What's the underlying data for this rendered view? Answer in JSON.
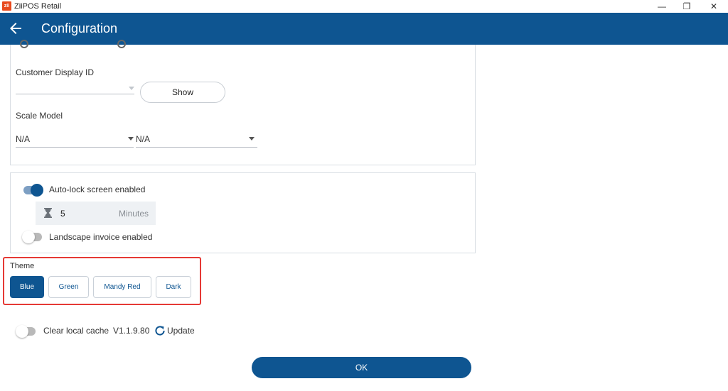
{
  "window": {
    "title": "ZiiPOS Retail",
    "logo_text": "zii",
    "minimize_glyph": "—",
    "restore_glyph": "❐",
    "close_glyph": "✕"
  },
  "appbar": {
    "title": "Configuration",
    "back_icon": "arrow-left-icon"
  },
  "customer_display": {
    "label": "Customer Display ID",
    "value": "",
    "show_button": "Show"
  },
  "scale": {
    "label": "Scale Model",
    "model_value": "N/A",
    "second_value": "N/A"
  },
  "auto_lock": {
    "label": "Auto-lock screen enabled",
    "enabled": true,
    "minutes_value": "5",
    "minutes_unit": "Minutes",
    "icon": "hourglass-icon"
  },
  "landscape_invoice": {
    "label": "Landscape invoice enabled",
    "enabled": false
  },
  "theme": {
    "label": "Theme",
    "options": [
      "Blue",
      "Green",
      "Mandy Red",
      "Dark"
    ],
    "selected": "Blue"
  },
  "cache": {
    "label": "Clear local cache",
    "enabled": false,
    "version": "V1.1.9.80",
    "update_label": "Update",
    "icon": "refresh-icon"
  },
  "ok_button": "OK",
  "colors": {
    "primary": "#0e5591",
    "highlight_border": "#e53935",
    "window_logo": "#e8491d"
  }
}
